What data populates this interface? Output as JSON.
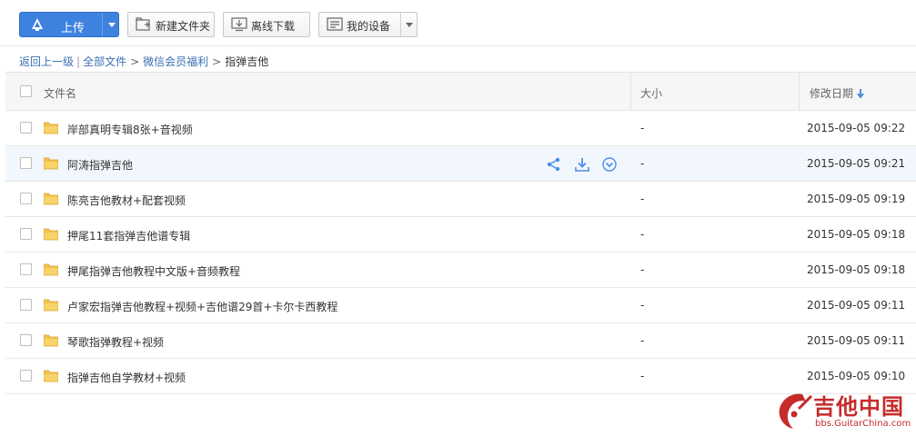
{
  "toolbar": {
    "upload_label": "上传",
    "mkdir_label": "新建文件夹",
    "offline_label": "离线下载",
    "device_label": "我的设备"
  },
  "breadcrumb": {
    "back": "返回上一级",
    "separator_pipe": "|",
    "items": [
      "全部文件",
      "微信会员福利",
      "指弹吉他"
    ],
    "separator": ">"
  },
  "table": {
    "headers": {
      "name": "文件名",
      "size": "大小",
      "date": "修改日期"
    },
    "rows": [
      {
        "name": "岸部真明专辑8张+音视频",
        "size": "-",
        "date": "2015-09-05 09:22"
      },
      {
        "name": "阿涛指弹吉他",
        "size": "-",
        "date": "2015-09-05 09:21"
      },
      {
        "name": "陈亮吉他教材+配套视频",
        "size": "-",
        "date": "2015-09-05 09:19"
      },
      {
        "name": "押尾11套指弹吉他谱专辑",
        "size": "-",
        "date": "2015-09-05 09:18"
      },
      {
        "name": "押尾指弹吉他教程中文版+音频教程",
        "size": "-",
        "date": "2015-09-05 09:18"
      },
      {
        "name": "卢家宏指弹吉他教程+视频+吉他谱29首+卡尔卡西教程",
        "size": "-",
        "date": "2015-09-05 09:11"
      },
      {
        "name": "琴歌指弹教程+视频",
        "size": "-",
        "date": "2015-09-05 09:11"
      },
      {
        "name": "指弹吉他自学教材+视频",
        "size": "-",
        "date": "2015-09-05 09:10"
      }
    ]
  },
  "watermark": {
    "title": "吉他中国",
    "subtitle": "bbs.GuitarChina.com"
  },
  "colors": {
    "accent": "#3e82e0",
    "link": "#3b6fb3",
    "folder": "#f2c24f",
    "hover_row": "#f2f7fd"
  }
}
